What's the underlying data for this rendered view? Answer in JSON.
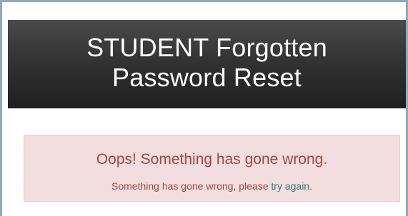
{
  "header": {
    "title_line1": "STUDENT Forgotten",
    "title_line2": "Password Reset"
  },
  "alert": {
    "heading": "Oops! Something has gone wrong.",
    "message_prefix": "Something has gone wrong, please ",
    "link_text": "try again",
    "message_suffix": "."
  },
  "colors": {
    "header_background": "#2b2b2b",
    "alert_background": "#f2dede",
    "alert_text": "#a94442",
    "link": "#2f7a78",
    "window_border": "#8fa8c4"
  }
}
